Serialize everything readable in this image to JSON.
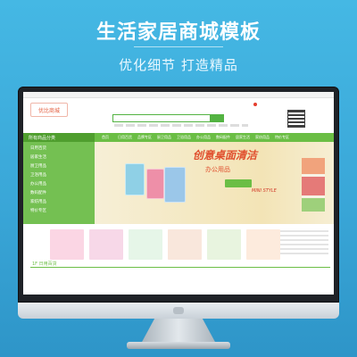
{
  "headline": "生活家居商城模板",
  "tagline": "优化细节 打造精品",
  "site": {
    "logo_text": "优比商城",
    "nav_category": "所有商品分类",
    "nav_items": [
      "首页",
      "日用百货",
      "品牌专区",
      "厨卫用品",
      "卫浴用品",
      "办公用品",
      "数码配件",
      "居家生活",
      "家纺用品",
      "特价专区"
    ],
    "side_items": [
      "日用百货",
      "居家生活",
      "厨卫用品",
      "卫浴用品",
      "办公用品",
      "数码配件",
      "家纺用品",
      "特价专区"
    ],
    "banner_title": "创意桌面清洁",
    "banner_sub": "办公用品",
    "banner_style": "MINI STYLE",
    "floor_label": "1F 日用百货"
  },
  "colors": {
    "background": "#3aa7d8",
    "accent_green": "#6bbe45",
    "accent_red": "#e04f2e",
    "bezel": "#1f2227"
  }
}
